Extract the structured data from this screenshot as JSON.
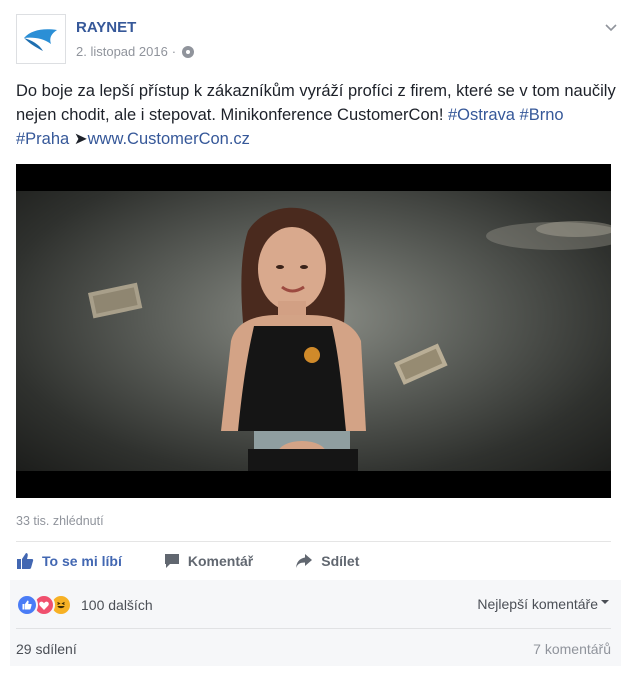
{
  "header": {
    "page_name": "RAYNET",
    "date": "2. listopad 2016",
    "separator": "·"
  },
  "post": {
    "text_main": "Do boje za lepší přístup k zákazníkům vyráží profíci z firem, které se v tom naučily nejen chodit, ale i stepovat. Minikonference CustomerCon! ",
    "hashtag_ostrava": "#Ostrava",
    "hashtag_brno": "#Brno",
    "hashtag_praha": "#Praha",
    "arrow": " ➤",
    "link": "www.CustomerCon.cz"
  },
  "video": {
    "views": "33 tis. zhlédnutí"
  },
  "actions": {
    "like": "To se mi líbí",
    "comment": "Komentář",
    "share": "Sdílet"
  },
  "feedback": {
    "reactions_more": "100 dalších",
    "best_comments": "Nejlepší komentáře",
    "shares": "29 sdílení",
    "comments": "7 komentářů"
  },
  "colors": {
    "brand_link": "#365899",
    "like_blue": "#4267b2",
    "muted": "#90949c",
    "logo_blue": "#2b8fd6"
  }
}
